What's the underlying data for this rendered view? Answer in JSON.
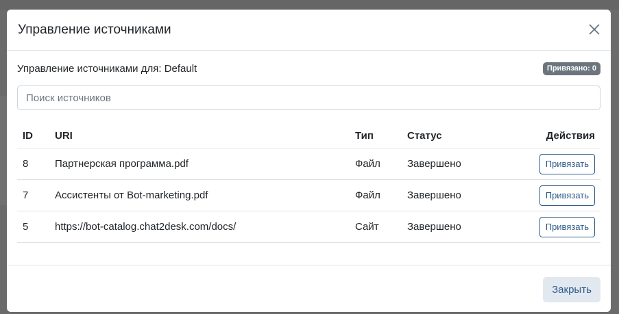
{
  "modal": {
    "title": "Управление источниками",
    "close_icon": "close-icon"
  },
  "body": {
    "subtitle_prefix": "Управление источниками для: ",
    "subtitle_target": "Default",
    "badge": "Привязано: 0",
    "search_placeholder": "Поиск источников"
  },
  "table": {
    "headers": {
      "id": "ID",
      "uri": "URI",
      "type": "Тип",
      "status": "Статус",
      "actions": "Действия"
    },
    "rows": [
      {
        "id": "8",
        "uri": "Партнерская программа.pdf",
        "type": "Файл",
        "status": "Завершено",
        "action": "Привязать"
      },
      {
        "id": "7",
        "uri": "Ассистенты от Bot-marketing.pdf",
        "type": "Файл",
        "status": "Завершено",
        "action": "Привязать"
      },
      {
        "id": "5",
        "uri": "https://bot-catalog.chat2desk.com/docs/",
        "type": "Сайт",
        "status": "Завершено",
        "action": "Привязать"
      }
    ]
  },
  "footer": {
    "close_label": "Закрыть"
  },
  "colors": {
    "badge_bg": "#6c757d",
    "accent": "#2e5c8a",
    "footer_button_bg": "#e2e8f0"
  }
}
